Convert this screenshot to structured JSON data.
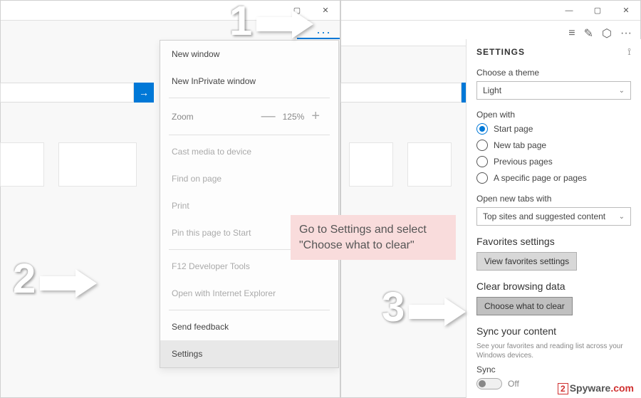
{
  "windowControls": {
    "minimize": "—",
    "maximize": "▢",
    "close": "✕"
  },
  "moreDots": "···",
  "toolbar": {
    "menuIcon": "≡",
    "editIcon": "✎",
    "shareIcon": "⬡",
    "moreIcon": "···"
  },
  "searchArrow": "→",
  "menu": {
    "newWindow": "New window",
    "newInPrivate": "New InPrivate window",
    "zoomLabel": "Zoom",
    "zoomMinus": "—",
    "zoomValue": "125%",
    "zoomPlus": "+",
    "castMedia": "Cast media to device",
    "findOnPage": "Find on page",
    "print": "Print",
    "pinToStart": "Pin this page to Start",
    "devTools": "F12 Developer Tools",
    "openIE": "Open with Internet Explorer",
    "sendFeedback": "Send feedback",
    "settings": "Settings"
  },
  "settingsPanel": {
    "title": "SETTINGS",
    "pinIcon": "⟟",
    "theme": {
      "label": "Choose a theme",
      "value": "Light"
    },
    "openWith": {
      "label": "Open with",
      "options": [
        "Start page",
        "New tab page",
        "Previous pages",
        "A specific page or pages"
      ],
      "selected": 0
    },
    "newTabs": {
      "label": "Open new tabs with",
      "value": "Top sites and suggested content"
    },
    "favorites": {
      "heading": "Favorites settings",
      "button": "View favorites settings"
    },
    "clearData": {
      "heading": "Clear browsing data",
      "button": "Choose what to clear"
    },
    "sync": {
      "heading": "Sync your content",
      "desc": "See your favorites and reading list across your Windows devices.",
      "label": "Sync",
      "state": "Off"
    }
  },
  "callout": "Go to Settings and select \"Choose what to clear\"",
  "steps": {
    "one": "1",
    "two": "2",
    "three": "3"
  },
  "watermark": {
    "badge": "2",
    "name": "Spyware",
    "tld": ".com"
  }
}
